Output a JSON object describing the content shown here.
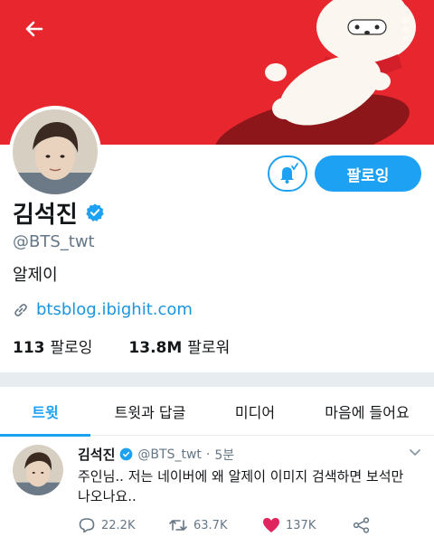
{
  "profile": {
    "name": "김석진",
    "handle": "@BTS_twt",
    "bio": "알제이",
    "link": "btsblog.ibighit.com",
    "following_count": "113",
    "following_label": "팔로잉",
    "followers_count": "13.8M",
    "followers_label": "팔로워",
    "follow_button_label": "팔로잉"
  },
  "tabs": [
    {
      "label": "트윗",
      "active": true
    },
    {
      "label": "트윗과 답글",
      "active": false
    },
    {
      "label": "미디어",
      "active": false
    },
    {
      "label": "마음에 들어요",
      "active": false
    }
  ],
  "tweet": {
    "name": "김석진",
    "handle": "@BTS_twt",
    "separator": "·",
    "time": "5분",
    "text_line1": "주인님.. 저는 네이버에 왜 알제이 이미지 검색하면 보석만",
    "text_line2": "나오나요..",
    "replies": "22.2K",
    "retweets": "63.7K",
    "likes": "137K"
  },
  "icons": {
    "back": "arrow-left-icon",
    "menu": "more-vertical-icon",
    "notify": "bell-check-icon",
    "verified": "verified-badge-icon",
    "link": "link-icon",
    "reply": "reply-icon",
    "retweet": "retweet-icon",
    "like": "heart-icon",
    "share": "share-icon"
  },
  "colors": {
    "banner": "#e8262e",
    "accent": "#1da1f2",
    "like": "#e0245e",
    "muted": "#657786"
  }
}
